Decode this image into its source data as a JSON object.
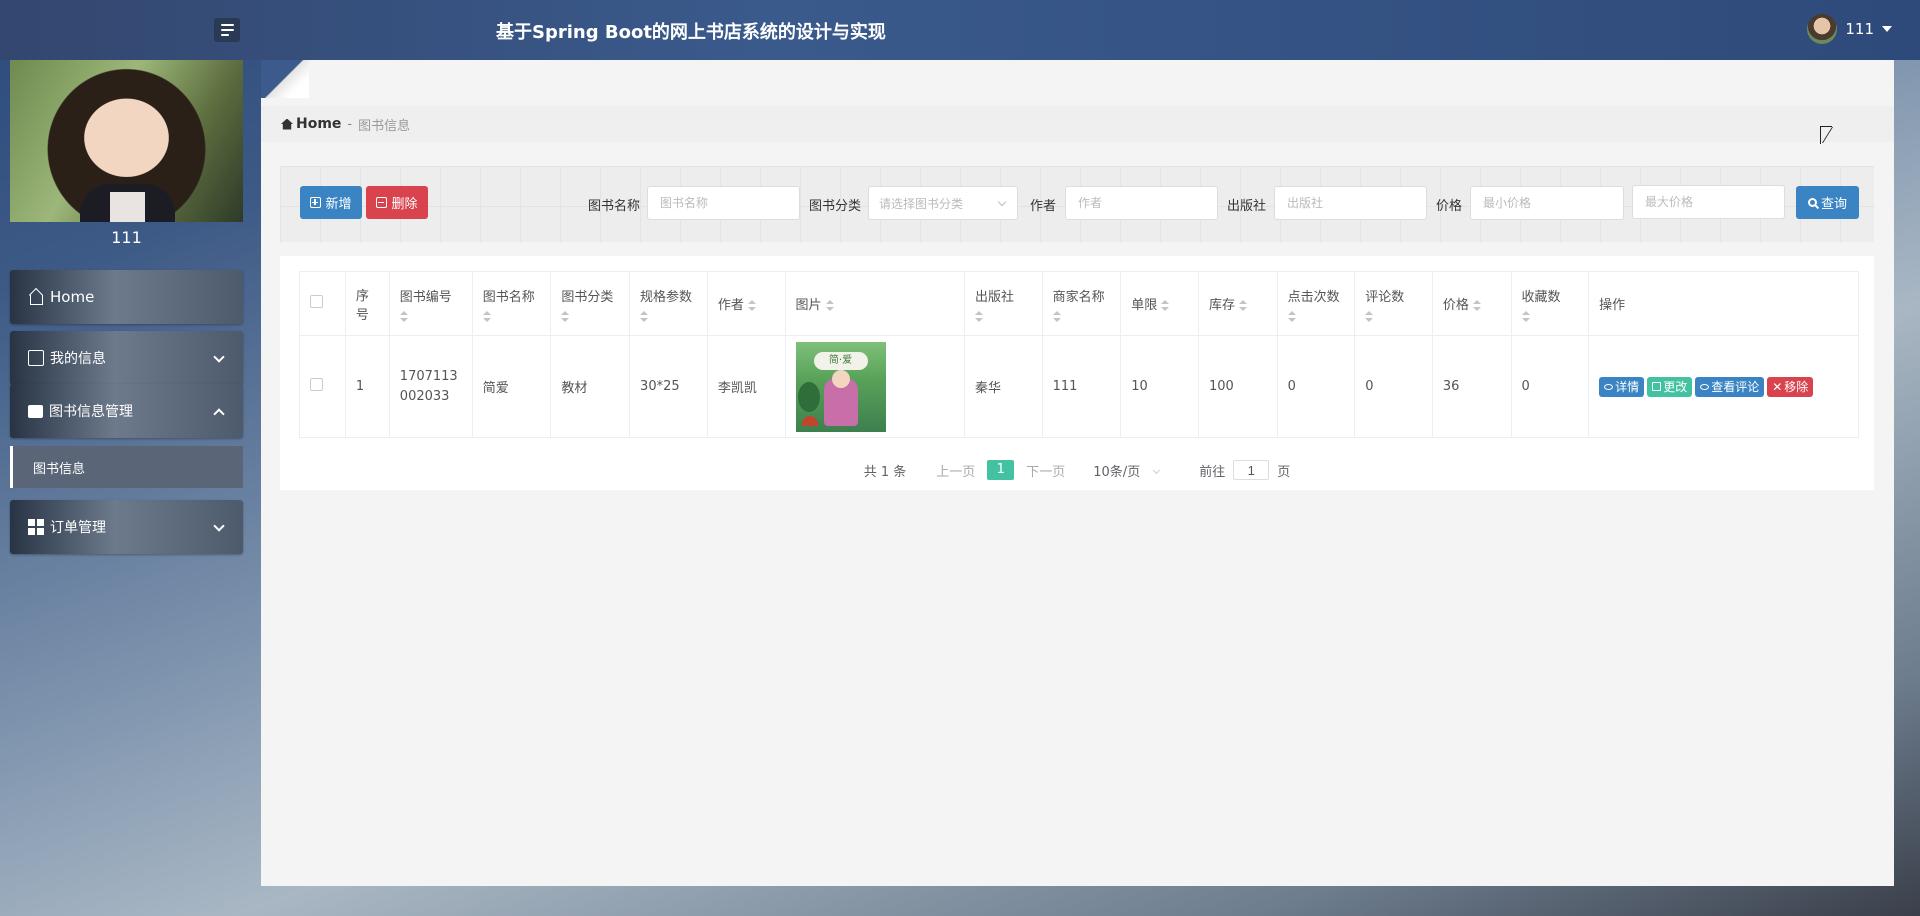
{
  "header": {
    "title": "基于Spring Boot的网上书店系统的设计与实现",
    "username": "111"
  },
  "sidebar": {
    "profile_name": "111",
    "items": [
      {
        "label": "Home"
      },
      {
        "label": "我的信息"
      },
      {
        "label": "图书信息管理"
      },
      {
        "label": "订单管理"
      }
    ],
    "sub_items": [
      {
        "label": "图书信息"
      }
    ]
  },
  "breadcrumb": {
    "home": "Home",
    "separator": "-",
    "current": "图书信息"
  },
  "toolbar": {
    "add_label": "新增",
    "delete_label": "删除",
    "search_label": "查询",
    "filters": {
      "name_label": "图书名称",
      "name_placeholder": "图书名称",
      "category_label": "图书分类",
      "category_placeholder": "请选择图书分类",
      "author_label": "作者",
      "author_placeholder": "作者",
      "publisher_label": "出版社",
      "publisher_placeholder": "出版社",
      "price_label": "价格",
      "min_price_placeholder": "最小价格",
      "max_price_placeholder": "最大价格"
    }
  },
  "table": {
    "headers": {
      "seq": "序号",
      "code": "图书编号",
      "name": "图书名称",
      "category": "图书分类",
      "spec": "规格参数",
      "author": "作者",
      "image": "图片",
      "publisher": "出版社",
      "merchant": "商家名称",
      "limit": "单限",
      "stock": "库存",
      "clicks": "点击次数",
      "comments": "评论数",
      "price": "价格",
      "favorites": "收藏数",
      "actions": "操作"
    },
    "rows": [
      {
        "seq": "1",
        "code": "1707113002033",
        "name": "简爱",
        "category": "教材",
        "spec": "30*25",
        "author": "李凯凯",
        "cover_title": "简·爱",
        "publisher": "秦华",
        "merchant": "111",
        "limit": "10",
        "stock": "100",
        "clicks": "0",
        "comments": "0",
        "price": "36",
        "favorites": "0"
      }
    ],
    "row_actions": {
      "detail": "详情",
      "edit": "更改",
      "view_comments": "查看评论",
      "remove": "移除"
    }
  },
  "pagination": {
    "total": "共 1 条",
    "prev": "上一页",
    "current_page": "1",
    "next": "下一页",
    "page_size": "10条/页",
    "goto_label": "前往",
    "goto_value": "1",
    "goto_suffix": "页"
  }
}
